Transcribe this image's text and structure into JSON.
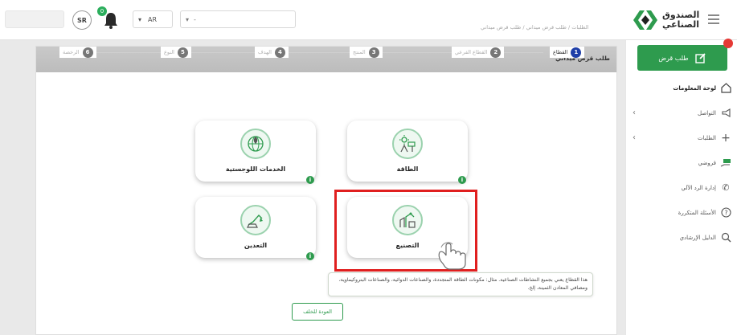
{
  "header": {
    "user_name": "",
    "currency_code": "SR",
    "notification_count": "0",
    "language_value": "AR",
    "unit_value": "-",
    "breadcrumb": "الطلبات / طلب قرض ميداني / طلب قرض ميداني",
    "logo_line1": "الصندوق",
    "logo_line2": "الصناعي",
    "brand_color": "#2e9b4e"
  },
  "sidebar": {
    "new_loan_label": "طلب قرض",
    "items": [
      {
        "label": "لوحة المعلومات",
        "icon": "home-icon"
      },
      {
        "label": "التواصل",
        "icon": "megaphone-icon"
      },
      {
        "label": "الطلبات",
        "icon": "plus-icon"
      },
      {
        "label": "قروضي",
        "icon": "hand-money-icon"
      },
      {
        "label": "إدارة الرد الآلي",
        "icon": "phone-icon"
      },
      {
        "label": "الأسئلة المتكررة",
        "icon": "question-icon"
      },
      {
        "label": "الدليل الإرشادي",
        "icon": "search-icon"
      }
    ]
  },
  "main": {
    "title": "طلب قرض ميداني",
    "steps": [
      {
        "num": "1",
        "label": "القطاع"
      },
      {
        "num": "2",
        "label": "القطاع الفرعي"
      },
      {
        "num": "3",
        "label": "المنتج"
      },
      {
        "num": "4",
        "label": "الهدف"
      },
      {
        "num": "5",
        "label": "النوع"
      },
      {
        "num": "6",
        "label": "الرخصة"
      }
    ],
    "cards": [
      {
        "label": "الطاقة",
        "icon": "energy-icon"
      },
      {
        "label": "الخدمات اللوجستية",
        "icon": "globe-logistics-icon"
      },
      {
        "label": "التصنيع",
        "icon": "factory-robot-icon"
      },
      {
        "label": "التعدين",
        "icon": "mining-excavator-icon"
      }
    ],
    "info_symbol": "i",
    "tooltip_text": "هذا القطاع يعني بجميع النشاطات الصناعية. مثال: مكونات الطاقة المتجددة، والصناعات الدوائية، والصناعات البتروكيماوية، ومصافي المعادن الثمينة، إلخ.",
    "back_label": "العودة للخلف"
  }
}
